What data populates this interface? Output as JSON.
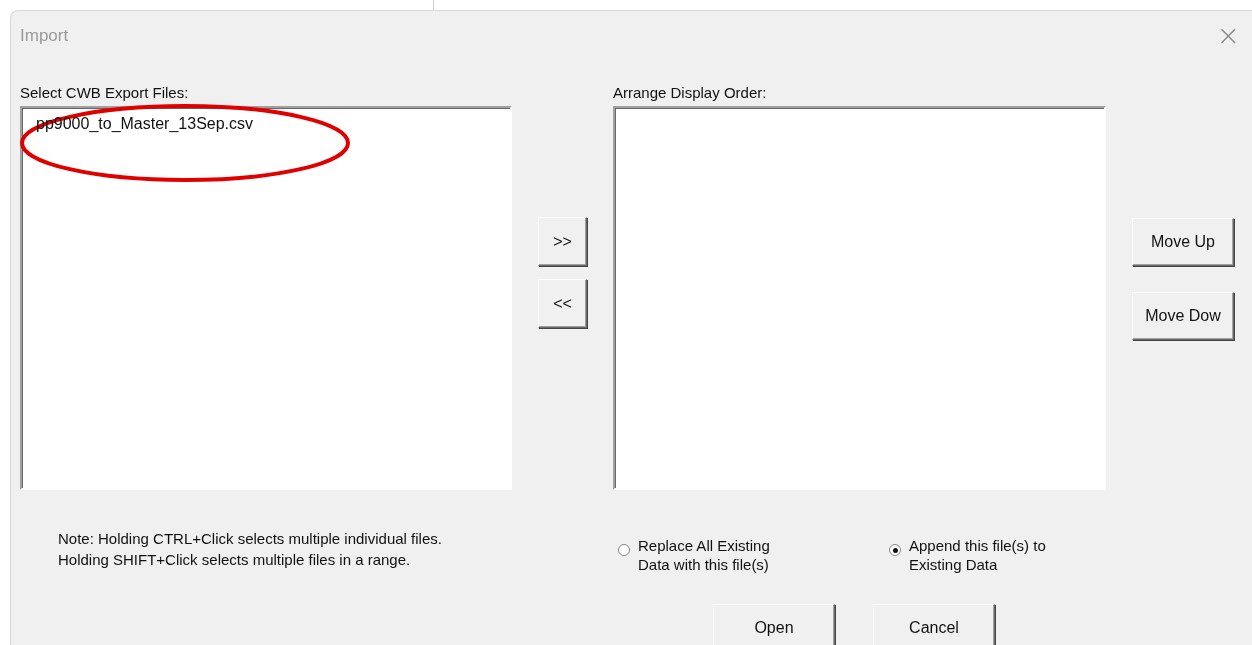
{
  "window": {
    "title": "Import",
    "close": "×"
  },
  "source_list": {
    "label": "Select CWB Export Files:",
    "items": [
      {
        "text": "pp9000_to_Master_13Sep.csv"
      }
    ]
  },
  "transfer_buttons": [
    ">>",
    "<<"
  ],
  "order_list": {
    "label": "Arrange Display Order:"
  },
  "order_buttons": [
    "Move Up",
    "Move Dow"
  ],
  "note": [
    "Note: Holding CTRL+Click selects multiple individual files.",
    "Holding SHIFT+Click selects multiple files in a range."
  ],
  "import_mode": [
    {
      "label": [
        "Replace All Existing",
        "Data with this file(s)"
      ],
      "selected": false
    },
    {
      "label": [
        "Append this file(s) to",
        "Existing Data"
      ],
      "selected": true
    }
  ],
  "buttons": [
    "Open",
    "Cancel"
  ]
}
